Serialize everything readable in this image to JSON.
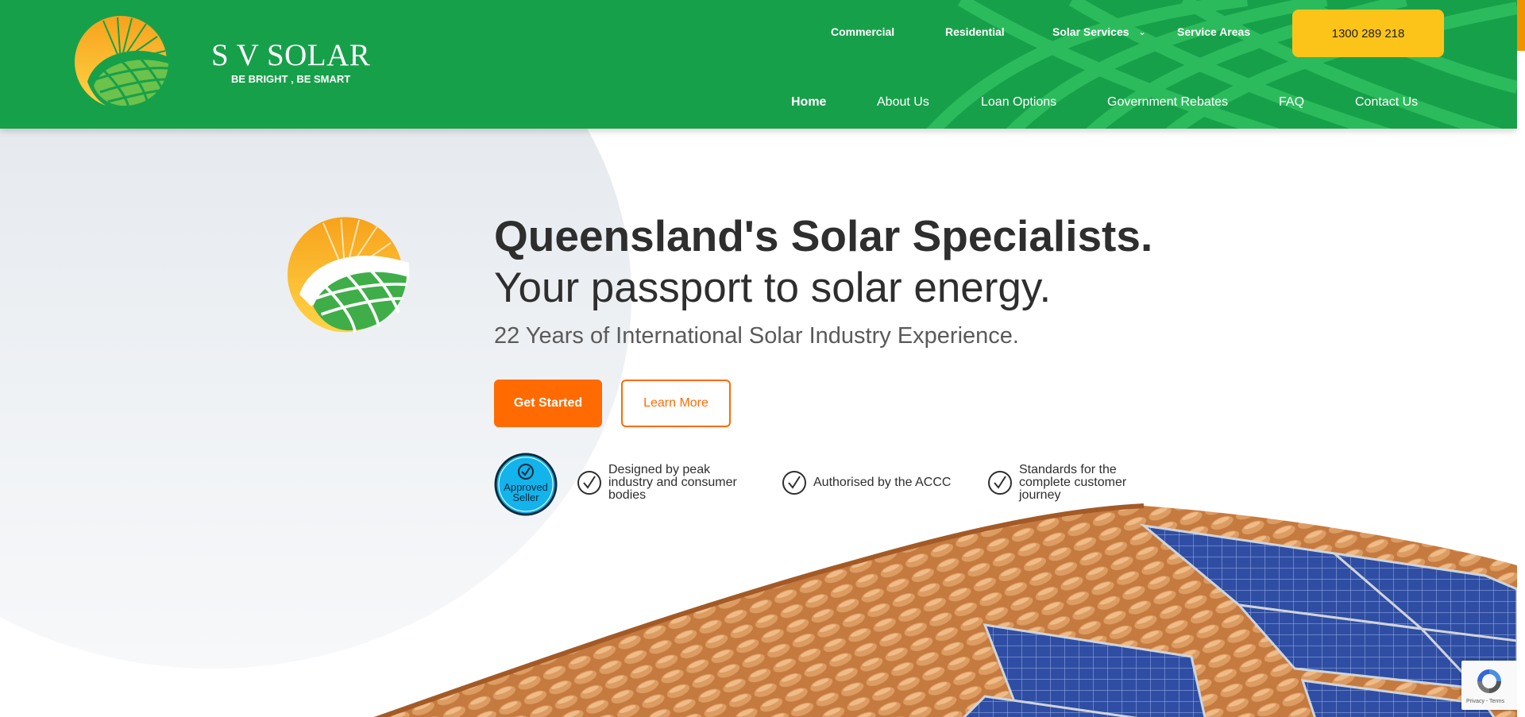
{
  "brand": {
    "name": "S V SOLAR",
    "tagline": "BE BRIGHT , BE SMART",
    "logo_icon": "sun-solar-panel-logo",
    "colors": {
      "header": "#17a04a",
      "accent_orange": "#ff6b00",
      "phone_yellow": "#fcc419"
    }
  },
  "nav": {
    "top": [
      {
        "label": "Commercial"
      },
      {
        "label": "Residential"
      },
      {
        "label": "Solar Services",
        "has_dropdown": true
      },
      {
        "label": "Service Areas"
      }
    ],
    "main": [
      {
        "label": "Home",
        "active": true
      },
      {
        "label": "About Us"
      },
      {
        "label": "Loan Options"
      },
      {
        "label": "Government Rebates"
      },
      {
        "label": "FAQ"
      },
      {
        "label": "Contact Us"
      }
    ],
    "phone": "1300 289 218"
  },
  "hero": {
    "headline": "Queensland's Solar Specialists.",
    "subheadline": "Your passport to solar energy.",
    "experience": "22 Years of International Solar Industry Experience.",
    "primary_button": "Get Started",
    "secondary_button": "Learn More",
    "badge": {
      "text_line1": "Approved",
      "text_line2": "Seller"
    },
    "features": [
      {
        "lines": [
          "Designed by peak",
          "industry and consumer",
          "bodies"
        ]
      },
      {
        "lines": [
          "Authorised by the ACCC"
        ]
      },
      {
        "lines": [
          "Standards for the",
          "complete customer",
          "journey"
        ]
      }
    ]
  },
  "recaptcha": {
    "text": "Privacy - Terms"
  }
}
